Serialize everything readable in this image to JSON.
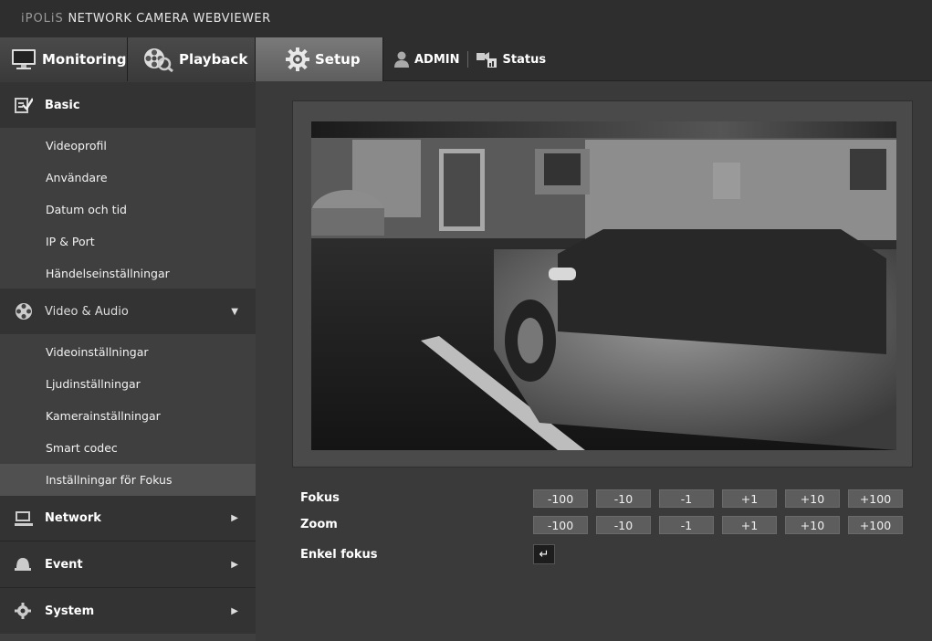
{
  "header": {
    "brand_prefix": "iPOLiS",
    "brand_title": "NETWORK CAMERA WEBVIEWER"
  },
  "nav": {
    "monitoring": "Monitoring",
    "playback": "Playback",
    "setup": "Setup",
    "user": "ADMIN",
    "status": "Status"
  },
  "sidebar": {
    "basic": {
      "label": "Basic",
      "items": [
        "Videoprofil",
        "Användare",
        "Datum och tid",
        "IP & Port",
        "Händelseinställningar"
      ]
    },
    "video_audio": {
      "label": "Video & Audio",
      "items": [
        "Videoinställningar",
        "Ljudinställningar",
        "Kamerainställningar",
        "Smart codec",
        "Inställningar för Fokus"
      ]
    },
    "network": {
      "label": "Network"
    },
    "event": {
      "label": "Event"
    },
    "system": {
      "label": "System"
    }
  },
  "controls": {
    "fokus_label": "Fokus",
    "zoom_label": "Zoom",
    "enkel_label": "Enkel fokus",
    "steps": [
      "-100",
      "-10",
      "-1",
      "+1",
      "+10",
      "+100"
    ],
    "enter_glyph": "↵"
  },
  "colors": {
    "background": "#3a3a3a",
    "header": "#2e2e2e",
    "active_tab": "#6b6b6b",
    "active_item": "#505050"
  }
}
